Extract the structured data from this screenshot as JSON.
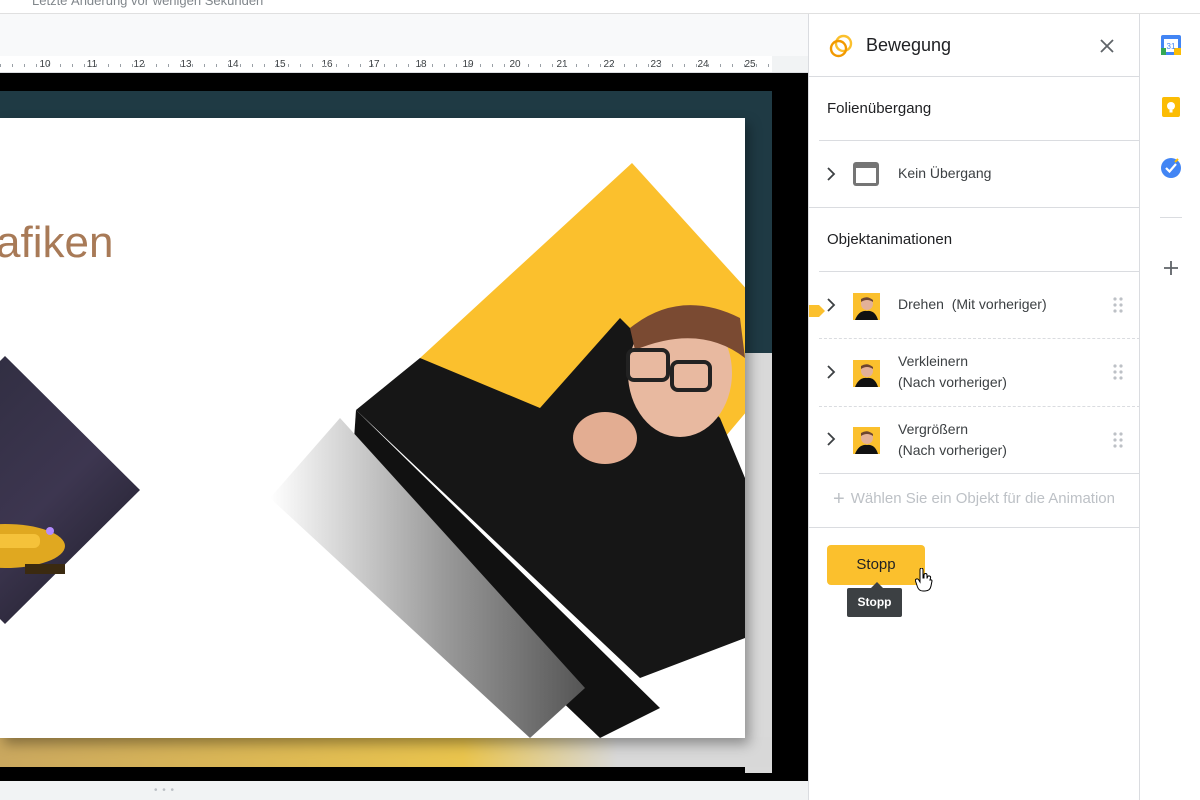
{
  "top_bar": {
    "last_edit": "Letzte Änderung vor wenigen Sekunden"
  },
  "ruler": {
    "ticks": [
      "10",
      "11",
      "12",
      "13",
      "14",
      "15",
      "16",
      "17",
      "18",
      "19",
      "20",
      "21",
      "22",
      "23",
      "24",
      "25"
    ]
  },
  "slide": {
    "title_fragment": "afiken"
  },
  "panel": {
    "title": "Bewegung",
    "transition_section": "Folienübergang",
    "transition_item": "Kein Übergang",
    "animations_section": "Objektanimationen",
    "animations": [
      {
        "line1": "Drehen  (Mit vorheriger)",
        "line2": ""
      },
      {
        "line1": "Verkleinern",
        "line2": "(Nach vorheriger)"
      },
      {
        "line1": "Vergrößern",
        "line2": "(Nach vorheriger)"
      }
    ],
    "add_placeholder": "Wählen Sie ein Objekt für die Animation",
    "stop_button": "Stopp",
    "tooltip": "Stopp"
  },
  "sidebar": {
    "icons": [
      "calendar-icon",
      "keep-icon",
      "tasks-icon",
      "add-icon"
    ],
    "calendar_day": "31"
  },
  "colors": {
    "accent_yellow": "#fbc02d",
    "title_brown": "#a87a57",
    "slide_frame": "#1f3a44"
  }
}
